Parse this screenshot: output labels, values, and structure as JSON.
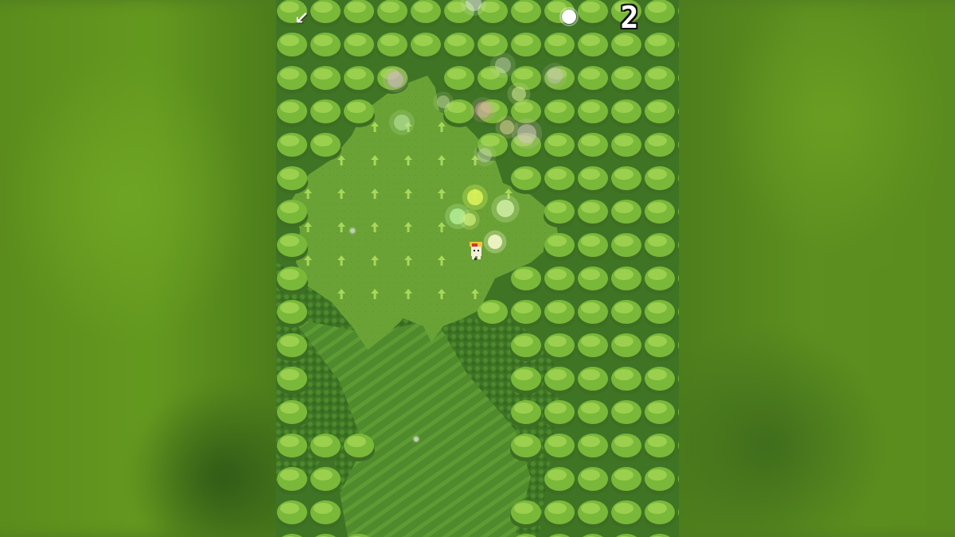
{
  "hud": {
    "back_icon": "↙",
    "collected_count": "2",
    "collectible_icon": "white-orb-icon"
  },
  "colors": {
    "tree_canopy": "#7ab83a",
    "tree_highlight": "#9ad04e",
    "tree_shadow": "#3e6e22",
    "forest_floor": "#4e8a2a",
    "clearing": "#6aa236",
    "clearing_arrow": "#a7d85a",
    "river": "#4f8a2c",
    "river_stripe": "#62a034",
    "hud_text": "#ffffff"
  }
}
